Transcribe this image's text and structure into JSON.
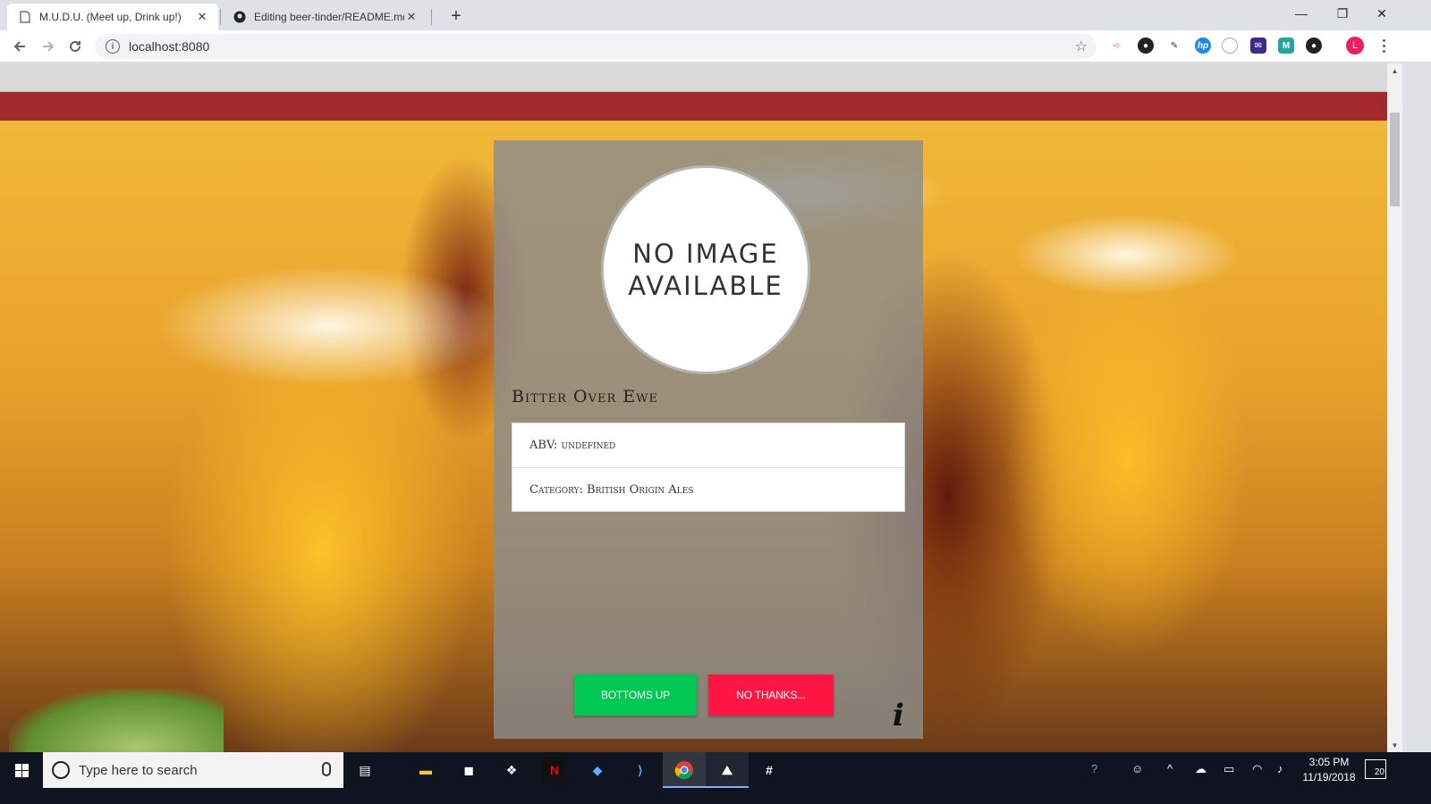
{
  "browser": {
    "tabs": [
      {
        "title": "M.U.D.U. (Meet up, Drink up!)",
        "active": true
      },
      {
        "title": "Editing beer-tinder/README.md",
        "active": false
      }
    ],
    "new_tab_symbol": "+",
    "url": "localhost:8080",
    "profile_initial": "L",
    "window_controls": {
      "minimize": "—",
      "restore": "❐",
      "close": "✕"
    },
    "extensions": [
      "cast-icon",
      "color-picker-icon",
      "eyedropper-icon",
      "hp-icon",
      "circle-ext-icon",
      "mail-ext-icon",
      "m-ext-icon",
      "dark-ext-icon"
    ]
  },
  "page": {
    "header_colors": {
      "grey_bar": "#d9d9d9",
      "red_bar": "#a3292b"
    },
    "card": {
      "image_placeholder_line1": "NO IMAGE",
      "image_placeholder_line2": "AVAILABLE",
      "beer_name": "Bitter Over Ewe",
      "abv": "ABV: undefined",
      "category": "Category: British Origin Ales",
      "accept_button": "BOTTOMS UP",
      "reject_button": "NO THANKS...",
      "info_symbol": "i"
    },
    "colors": {
      "accept": "#00c853",
      "reject": "#ff1744"
    }
  },
  "taskbar": {
    "search_placeholder": "Type here to search",
    "apps": [
      "task-view-icon",
      "file-explorer-icon",
      "store-icon",
      "dropbox-icon",
      "netflix-icon",
      "sourcetree-icon",
      "vscode-icon",
      "chrome-icon",
      "photos-icon",
      "slack-icon"
    ],
    "time": "3:05 PM",
    "date": "11/19/2018",
    "notifications": "20"
  }
}
